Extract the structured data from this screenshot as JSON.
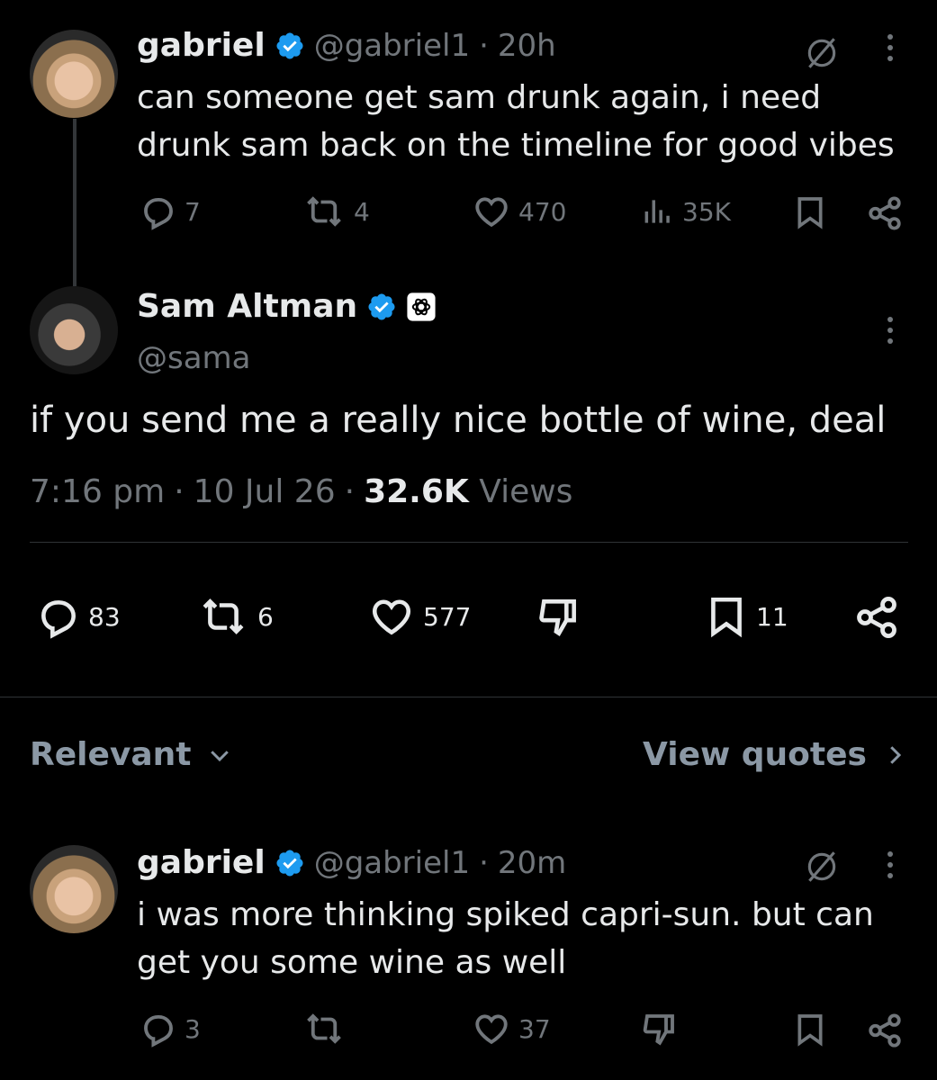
{
  "tweet1": {
    "name": "gabriel",
    "handle": "@gabriel1",
    "sep": "·",
    "time": "20h",
    "text_line1": "can someone get sam drunk again, i need",
    "text_line2": "drunk sam back on the timeline for good vibes",
    "replies": "7",
    "reposts": "4",
    "likes": "470",
    "views": "35K"
  },
  "main": {
    "name": "Sam Altman",
    "handle": "@sama",
    "text": "if you send me a really nice bottle of wine, deal",
    "time": "7:16 pm",
    "date": "10 Jul 26",
    "views_count": "32.6K",
    "views_label": "Views",
    "sep": "·",
    "replies": "83",
    "reposts": "6",
    "likes": "577",
    "bookmarks": "11"
  },
  "sort": {
    "relevant_label": "Relevant",
    "view_quotes_label": "View quotes"
  },
  "reply": {
    "name": "gabriel",
    "handle": "@gabriel1",
    "sep": "·",
    "time": "20m",
    "text_line1": "i was more thinking spiked capri-sun. but can",
    "text_line2": "get you some wine as well",
    "replies": "3",
    "likes": "37"
  },
  "colors": {
    "background": "#000000",
    "text": "#e7e9ea",
    "muted": "#71767b",
    "verified": "#1d9bf0"
  }
}
